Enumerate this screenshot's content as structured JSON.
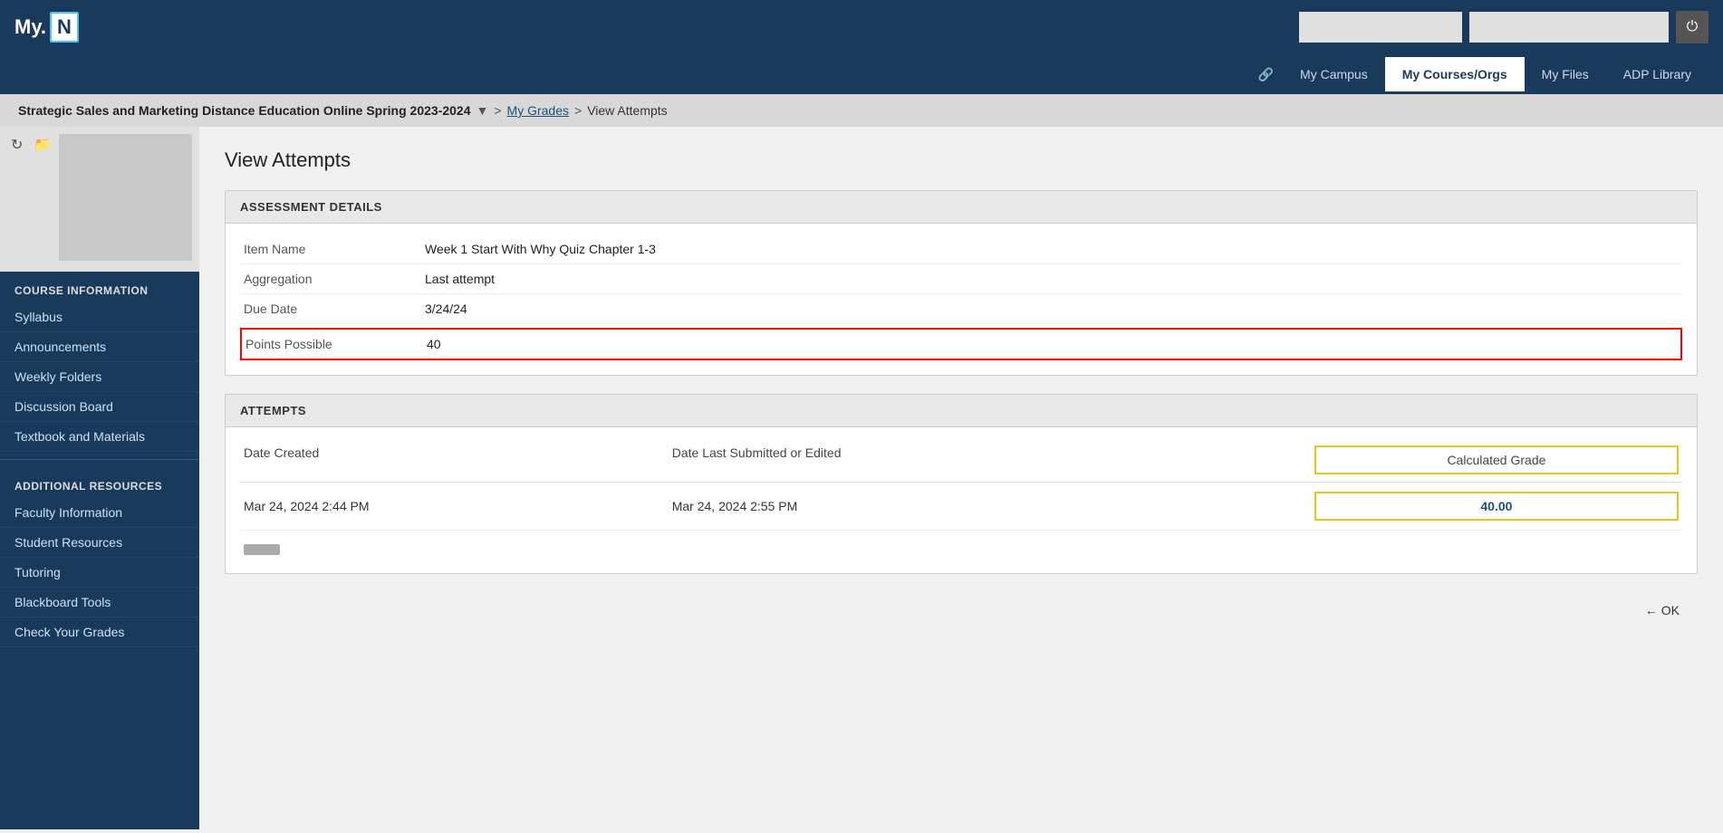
{
  "header": {
    "logo_my": "My.",
    "logo_n": "N",
    "power_icon": "⏻"
  },
  "nav": {
    "pin_icon": "🔗",
    "links": [
      {
        "label": "My Campus",
        "active": false
      },
      {
        "label": "My Courses/Orgs",
        "active": true
      },
      {
        "label": "My Files",
        "active": false
      },
      {
        "label": "ADP Library",
        "active": false
      }
    ]
  },
  "breadcrumb": {
    "course": "Strategic Sales and Marketing Distance Education Online Spring 2023-2024",
    "dropdown_icon": "▼",
    "sep1": ">",
    "grades_link": "My Grades",
    "sep2": ">",
    "current": "View Attempts"
  },
  "sidebar": {
    "refresh_icon": "↻",
    "folder_icon": "📁",
    "course_info_title": "COURSE INFORMATION",
    "course_info_items": [
      {
        "label": "Syllabus"
      },
      {
        "label": "Announcements"
      },
      {
        "label": "Weekly Folders"
      },
      {
        "label": "Discussion Board"
      },
      {
        "label": "Textbook and Materials"
      }
    ],
    "additional_resources_title": "ADDITIONAL RESOURCES",
    "additional_resources_items": [
      {
        "label": "Faculty Information"
      },
      {
        "label": "Student Resources"
      },
      {
        "label": "Tutoring"
      },
      {
        "label": "Blackboard Tools"
      },
      {
        "label": "Check Your Grades"
      }
    ]
  },
  "content": {
    "page_title": "View Attempts",
    "assessment_section_title": "ASSESSMENT DETAILS",
    "fields": [
      {
        "label": "Item Name",
        "value": "Week 1 Start With Why Quiz Chapter 1-3"
      },
      {
        "label": "Aggregation",
        "value": "Last attempt"
      },
      {
        "label": "Due Date",
        "value": "3/24/24"
      },
      {
        "label": "Points Possible",
        "value": "40",
        "highlighted": true
      }
    ],
    "attempts_section_title": "ATTEMPTS",
    "attempts_columns": {
      "date_created": "Date Created",
      "date_submitted": "Date Last Submitted or Edited",
      "calculated_grade": "Calculated Grade"
    },
    "attempts_rows": [
      {
        "date_created": "Mar 24, 2024 2:44 PM",
        "date_submitted": "Mar 24, 2024 2:55 PM",
        "calculated_grade": "40.00"
      }
    ],
    "ok_arrow": "←",
    "ok_label": "OK"
  }
}
